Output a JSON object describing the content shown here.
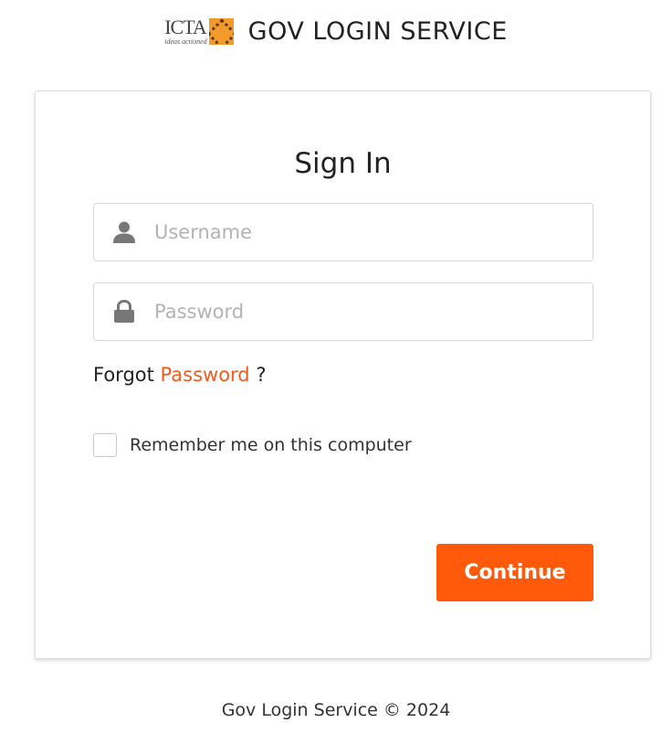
{
  "header": {
    "logo": {
      "main": "ICTA",
      "tagline": "ideas actioned"
    },
    "title": "GOV LOGIN SERVICE"
  },
  "signin": {
    "title": "Sign In",
    "username": {
      "placeholder": "Username",
      "value": "",
      "icon": "user-icon"
    },
    "password": {
      "placeholder": "Password",
      "value": "",
      "icon": "lock-icon"
    },
    "forgot": {
      "prefix": "Forgot",
      "link": "Password",
      "suffix": "?"
    },
    "remember": {
      "label": "Remember me on this computer",
      "checked": false
    },
    "continue_label": "Continue"
  },
  "footer": {
    "text": "Gov Login Service © 2024"
  },
  "colors": {
    "accent": "#ff5a0a",
    "link": "#f05a1f",
    "logo_orange": "#f39a2d",
    "border": "#d6d6d6"
  }
}
